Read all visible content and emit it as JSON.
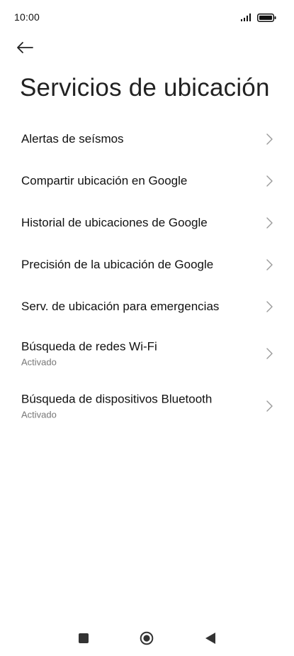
{
  "status_bar": {
    "time": "10:00"
  },
  "header": {
    "title": "Servicios de ubicación"
  },
  "settings": {
    "items": [
      {
        "label": "Alertas de seísmos"
      },
      {
        "label": "Compartir ubicación en Google"
      },
      {
        "label": "Historial de ubicaciones de Google"
      },
      {
        "label": "Precisión de la ubicación de Google"
      },
      {
        "label": "Serv. de ubicación para emergencias"
      },
      {
        "label": "Búsqueda de redes Wi-Fi",
        "sublabel": "Activado"
      },
      {
        "label": "Búsqueda de dispositivos Bluetooth",
        "sublabel": "Activado"
      }
    ]
  }
}
